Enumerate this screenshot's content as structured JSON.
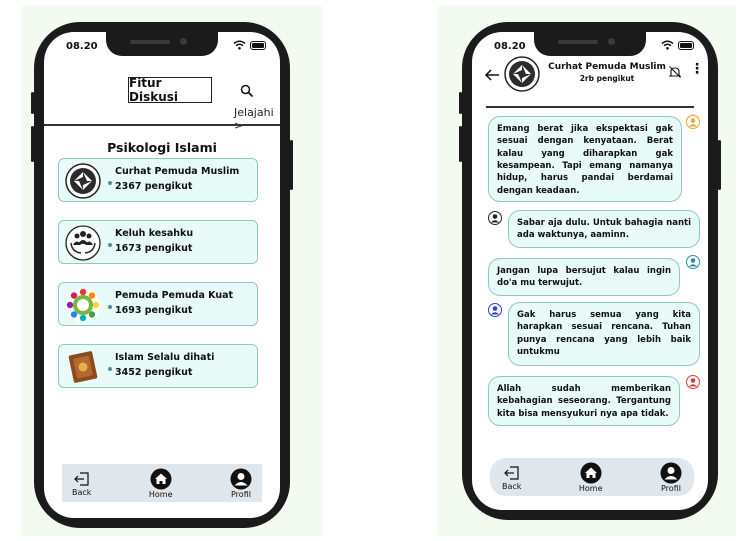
{
  "left_phone": {
    "status_time": "08.20",
    "title": "Fitur Diskusi",
    "explore_label": "Jelajahi >",
    "section_title": "Psikologi Islami",
    "groups": [
      {
        "name": "Curhat Pemuda Muslim",
        "followers": "2367 pengikut",
        "icon": "hands-circle-icon"
      },
      {
        "name": "Keluh kesahku",
        "followers": "1673 pengikut",
        "icon": "people-hands-icon"
      },
      {
        "name": "Pemuda Pemuda Kuat",
        "followers": "1693 pengikut",
        "icon": "people-circle-icon"
      },
      {
        "name": "Islam Selalu dihati",
        "followers": "3452 pengikut",
        "icon": "quran-book-icon"
      }
    ],
    "nav": {
      "back": "Back",
      "home": "Home",
      "profile": "Profil"
    }
  },
  "right_phone": {
    "status_time": "08.20",
    "group_name": "Curhat Pemuda Muslim",
    "group_followers": "2rb pengikut",
    "messages": [
      {
        "text": "Emang berat jika ekspektasi gak sesuai dengan kenyataan. Berat kalau yang diharapkan gak kesampean. Tapi emang namanya hidup, harus pandai berdamai dengan keadaan.",
        "avatar_color": "#f2a33a"
      },
      {
        "text": "Sabar aja dulu. Untuk bahagia nanti ada waktunya, aaminn.",
        "avatar_color": "#222222"
      },
      {
        "text": "Jangan lupa bersujut kalau ingin do'a mu terwujut.",
        "avatar_color": "#2a8fa5"
      },
      {
        "text": "Gak harus semua yang kita harapkan sesuai rencana. Tuhan punya rencana yang lebih baik untukmu",
        "avatar_color": "#2a3fd1"
      },
      {
        "text": "Allah sudah memberikan kebahagian seseorang. Tergantung kita bisa mensyukuri nya apa tidak.",
        "avatar_color": "#e03a3a"
      }
    ],
    "nav": {
      "back": "Back",
      "home": "Home",
      "profile": "Profil"
    }
  },
  "colors": {
    "panel_bg": "#f3fbf0",
    "card_bg": "#e9fbf8",
    "card_border": "#8fc9c0",
    "navbar_bg": "#dfe6ec",
    "phone_frame": "#1b1b1b"
  }
}
